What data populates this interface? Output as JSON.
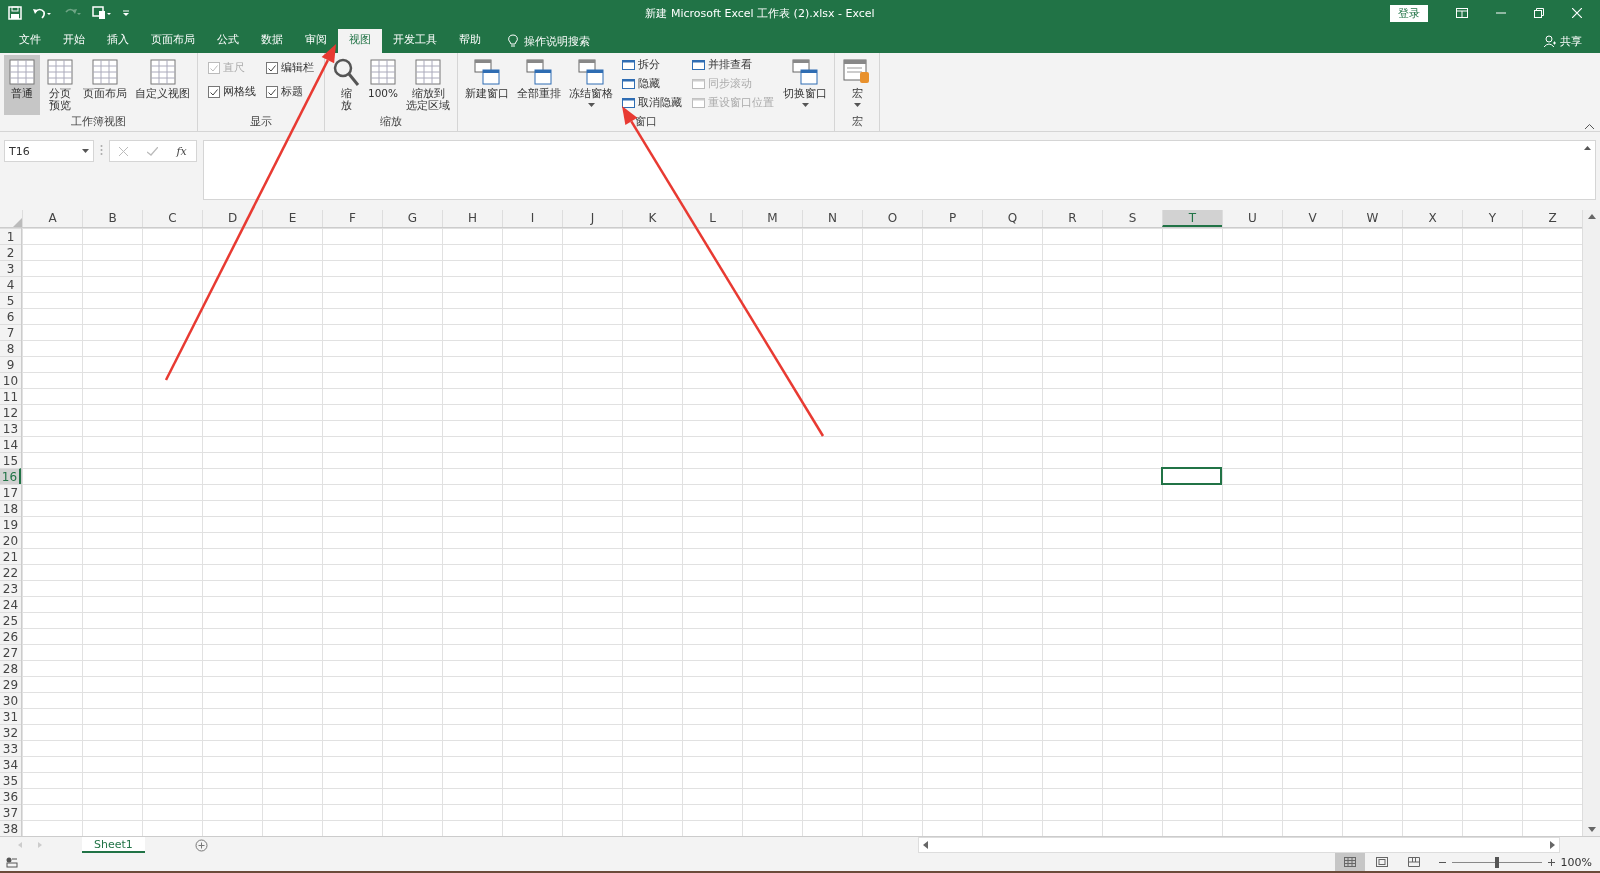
{
  "window": {
    "title": "新建 Microsoft Excel 工作表 (2).xlsx  -  Excel",
    "sign_in": "登录"
  },
  "tabs": [
    {
      "label": "文件",
      "selected": false
    },
    {
      "label": "开始",
      "selected": false
    },
    {
      "label": "插入",
      "selected": false
    },
    {
      "label": "页面布局",
      "selected": false
    },
    {
      "label": "公式",
      "selected": false
    },
    {
      "label": "数据",
      "selected": false
    },
    {
      "label": "审阅",
      "selected": false
    },
    {
      "label": "视图",
      "selected": true
    },
    {
      "label": "开发工具",
      "selected": false
    },
    {
      "label": "帮助",
      "selected": false
    }
  ],
  "tell_me": "操作说明搜索",
  "share": "共享",
  "ribbon": [
    {
      "label": "工作簿视图",
      "items": [
        {
          "kind": "big",
          "label": "普通",
          "selected": true,
          "dropdown": false
        },
        {
          "kind": "big",
          "lines": [
            "分页",
            "预览"
          ],
          "selected": false,
          "dropdown": false
        },
        {
          "kind": "big",
          "label": "页面布局",
          "selected": false,
          "dropdown": false
        },
        {
          "kind": "big",
          "label": "自定义视图",
          "selected": false,
          "dropdown": false
        }
      ]
    },
    {
      "label": "显示",
      "items": [
        {
          "kind": "checks",
          "items": [
            {
              "label": "直尺",
              "checked": true,
              "disabled": true
            },
            {
              "label": "编辑栏",
              "checked": true,
              "disabled": false
            },
            {
              "label": "网格线",
              "checked": true,
              "disabled": false
            },
            {
              "label": "标题",
              "checked": true,
              "disabled": false
            }
          ]
        }
      ]
    },
    {
      "label": "缩放",
      "items": [
        {
          "kind": "big",
          "lines": [
            "缩",
            "放"
          ],
          "selected": false,
          "dropdown": false
        },
        {
          "kind": "big",
          "label": "100%",
          "selected": false,
          "dropdown": false
        },
        {
          "kind": "big",
          "lines": [
            "缩放到",
            "选定区域"
          ],
          "selected": false,
          "dropdown": false
        }
      ]
    },
    {
      "label": "窗口",
      "items": [
        {
          "kind": "big",
          "label": "新建窗口",
          "selected": false,
          "dropdown": false
        },
        {
          "kind": "big",
          "label": "全部重排",
          "selected": false,
          "dropdown": false
        },
        {
          "kind": "big",
          "label": "冻结窗格",
          "selected": false,
          "dropdown": true
        },
        {
          "kind": "stack",
          "items": [
            {
              "label": "拆分",
              "disabled": false
            },
            {
              "label": "隐藏",
              "disabled": false
            },
            {
              "label": "取消隐藏",
              "disabled": false
            }
          ]
        },
        {
          "kind": "stack",
          "items": [
            {
              "label": "并排查看",
              "disabled": false
            },
            {
              "label": "同步滚动",
              "disabled": true
            },
            {
              "label": "重设窗口位置",
              "disabled": true
            }
          ]
        },
        {
          "kind": "big",
          "label": "切换窗口",
          "selected": false,
          "dropdown": true
        }
      ]
    },
    {
      "label": "宏",
      "items": [
        {
          "kind": "big",
          "label": "宏",
          "selected": false,
          "dropdown": true
        }
      ]
    }
  ],
  "name_box": "T16",
  "function_button": "fx",
  "columns": [
    {
      "label": "A",
      "selected": false
    },
    {
      "label": "B",
      "selected": false
    },
    {
      "label": "C",
      "selected": false
    },
    {
      "label": "D",
      "selected": false
    },
    {
      "label": "E",
      "selected": false
    },
    {
      "label": "F",
      "selected": false
    },
    {
      "label": "G",
      "selected": false
    },
    {
      "label": "H",
      "selected": false
    },
    {
      "label": "I",
      "selected": false
    },
    {
      "label": "J",
      "selected": false
    },
    {
      "label": "K",
      "selected": false
    },
    {
      "label": "L",
      "selected": false
    },
    {
      "label": "M",
      "selected": false
    },
    {
      "label": "N",
      "selected": false
    },
    {
      "label": "O",
      "selected": false
    },
    {
      "label": "P",
      "selected": false
    },
    {
      "label": "Q",
      "selected": false
    },
    {
      "label": "R",
      "selected": false
    },
    {
      "label": "S",
      "selected": false
    },
    {
      "label": "T",
      "selected": true
    },
    {
      "label": "U",
      "selected": false
    },
    {
      "label": "V",
      "selected": false
    },
    {
      "label": "W",
      "selected": false
    },
    {
      "label": "X",
      "selected": false
    },
    {
      "label": "Y",
      "selected": false
    },
    {
      "label": "Z",
      "selected": false
    }
  ],
  "rows": [
    {
      "label": "1",
      "selected": false
    },
    {
      "label": "2",
      "selected": false
    },
    {
      "label": "3",
      "selected": false
    },
    {
      "label": "4",
      "selected": false
    },
    {
      "label": "5",
      "selected": false
    },
    {
      "label": "6",
      "selected": false
    },
    {
      "label": "7",
      "selected": false
    },
    {
      "label": "8",
      "selected": false
    },
    {
      "label": "9",
      "selected": false
    },
    {
      "label": "10",
      "selected": false
    },
    {
      "label": "11",
      "selected": false
    },
    {
      "label": "12",
      "selected": false
    },
    {
      "label": "13",
      "selected": false
    },
    {
      "label": "14",
      "selected": false
    },
    {
      "label": "15",
      "selected": false
    },
    {
      "label": "16",
      "selected": true
    },
    {
      "label": "17",
      "selected": false
    },
    {
      "label": "18",
      "selected": false
    },
    {
      "label": "19",
      "selected": false
    },
    {
      "label": "20",
      "selected": false
    },
    {
      "label": "21",
      "selected": false
    },
    {
      "label": "22",
      "selected": false
    },
    {
      "label": "23",
      "selected": false
    },
    {
      "label": "24",
      "selected": false
    },
    {
      "label": "25",
      "selected": false
    },
    {
      "label": "26",
      "selected": false
    },
    {
      "label": "27",
      "selected": false
    },
    {
      "label": "28",
      "selected": false
    },
    {
      "label": "29",
      "selected": false
    },
    {
      "label": "30",
      "selected": false
    },
    {
      "label": "31",
      "selected": false
    },
    {
      "label": "32",
      "selected": false
    },
    {
      "label": "33",
      "selected": false
    },
    {
      "label": "34",
      "selected": false
    },
    {
      "label": "35",
      "selected": false
    },
    {
      "label": "36",
      "selected": false
    },
    {
      "label": "37",
      "selected": false
    },
    {
      "label": "38",
      "selected": false
    }
  ],
  "sheets": [
    {
      "label": "Sheet1",
      "selected": true
    }
  ],
  "status_bar": {
    "views": [
      {
        "selected": true
      },
      {
        "selected": false
      },
      {
        "selected": false
      }
    ],
    "zoom": {
      "level": 0.5,
      "reading": "100%"
    }
  }
}
